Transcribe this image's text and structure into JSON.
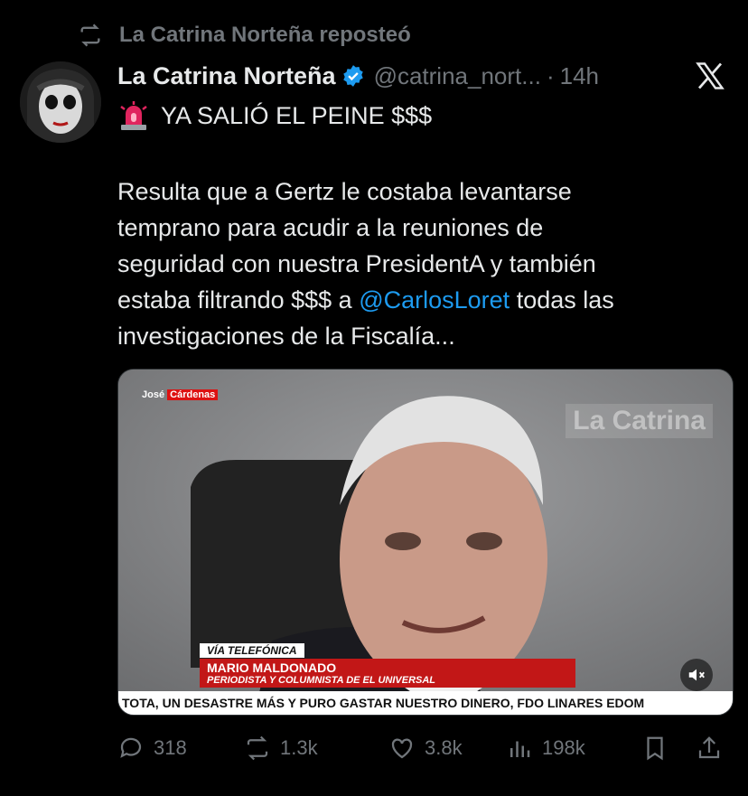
{
  "repost": {
    "text": "La Catrina Norteña reposteó",
    "icon": "repost-icon"
  },
  "author": {
    "name": "La Catrina Norteña",
    "handle": "@catrina_nort...",
    "time": "14h",
    "verified": true
  },
  "post": {
    "headline": "YA SALIÓ EL PEINE $$$",
    "lines": {
      "l1": "Resulta que a Gertz le costaba levantarse",
      "l2": "temprano para acudir a la reuniones de",
      "l3": "seguridad con nuestra PresidentA y también",
      "l4a": "estaba filtrando $$$ a ",
      "l4mention": "@CarlosLoret",
      "l4b": " todas las",
      "l5": "investigaciones de la Fiscalía..."
    }
  },
  "media": {
    "logo_prefix": "José",
    "logo_brand": "Cárdenas",
    "watermark": "La Catrina",
    "lower_third_tag": "VÍA TELEFÓNICA",
    "lower_third_name": "MARIO MALDONADO",
    "lower_third_role": "PERIODISTA Y COLUMNISTA DE EL UNIVERSAL",
    "ticker": "TOTA, UN DESASTRE MÁS Y PURO GASTAR NUESTRO DINERO, FDO LINARES EDOM"
  },
  "actions": {
    "replies": "318",
    "reposts": "1.3k",
    "likes": "3.8k",
    "views": "198k"
  },
  "colors": {
    "accent": "#1d9bf0",
    "muted": "#71767b",
    "background": "#000000",
    "lower_third_red": "#c21717"
  }
}
